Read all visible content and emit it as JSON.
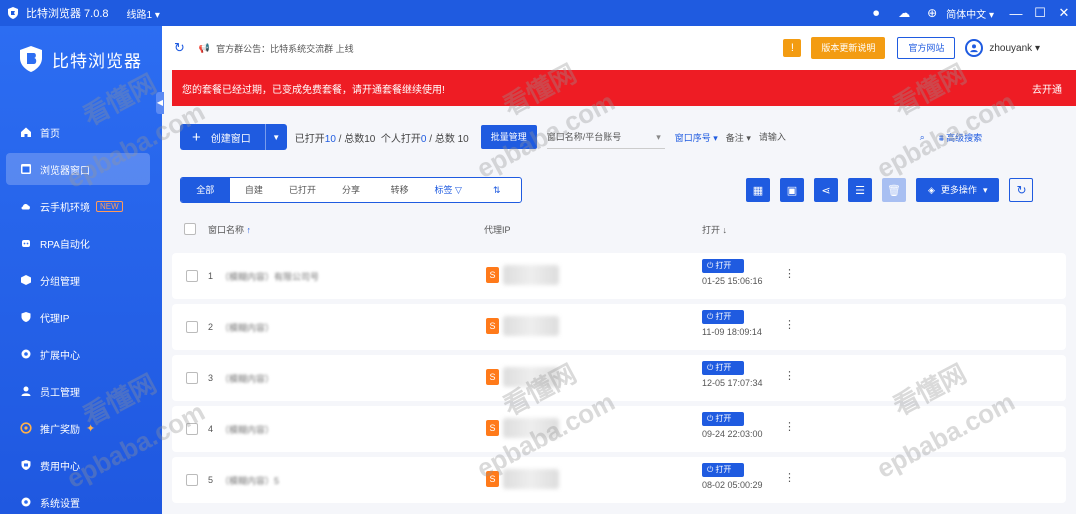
{
  "titlebar": {
    "app_title": "比特浏览器 7.0.8",
    "line_select": "线路1",
    "language": "简体中文",
    "minimize": "—",
    "maximize": "☐",
    "close": "✕"
  },
  "sidebar": {
    "brand": "比特浏览器",
    "items": [
      {
        "label": "首页"
      },
      {
        "label": "浏览器窗口"
      },
      {
        "label": "云手机环境",
        "badge": "NEW"
      },
      {
        "label": "RPA自动化"
      },
      {
        "label": "分组管理"
      },
      {
        "label": "代理IP"
      },
      {
        "label": "扩展中心"
      },
      {
        "label": "员工管理"
      },
      {
        "label": "推广奖励"
      },
      {
        "label": "费用中心"
      },
      {
        "label": "系统设置"
      }
    ]
  },
  "header": {
    "notice_text": "官方群公告：比特系统交流群 上线",
    "upgrade_btn": "版本更新说明",
    "website_btn": "官方网站",
    "username": "zhouyank"
  },
  "banner": {
    "text": "您的套餐已经过期，已变成免费套餐，请开通套餐继续使用!",
    "renew": "去开通"
  },
  "toolbar": {
    "new_btn": "创建窗口",
    "stats_open_label": "已打开",
    "stats_open": "10",
    "stats_total_label": "/ 总数",
    "stats_total": "10",
    "stats_mine_label": "个人打开",
    "stats_mine": "0",
    "stats_mine_total": "/ 总数 10",
    "batch_btn": "批量管理",
    "window_select": "窗口名称/平台账号",
    "filter_group": "窗口序号",
    "filter_note": "备注",
    "search_placeholder": "请输入",
    "advanced": "高级搜索"
  },
  "tabs": [
    "全部",
    "自建",
    "已打开",
    "分享",
    "转移",
    "标签"
  ],
  "ops": {
    "more": "更多操作"
  },
  "table": {
    "col_name": "窗口名称",
    "col_proxy": "代理IP",
    "col_open": "打开",
    "rows": [
      {
        "idx": "1",
        "name": "（模糊内容）有限公司号",
        "open_label": "打开",
        "time": "01-25 15:06:16"
      },
      {
        "idx": "2",
        "name": "（模糊内容）",
        "open_label": "打开",
        "time": "11-09 18:09:14"
      },
      {
        "idx": "3",
        "name": "（模糊内容）",
        "open_label": "打开",
        "time": "12-05 17:07:34"
      },
      {
        "idx": "4",
        "name": "（模糊内容）",
        "open_label": "打开",
        "time": "09-24 22:03:00"
      },
      {
        "idx": "5",
        "name": "（模糊内容）5",
        "open_label": "打开",
        "time": "08-02 05:00:29"
      }
    ]
  },
  "watermarks": [
    "看懂网",
    "epbaba.com"
  ]
}
